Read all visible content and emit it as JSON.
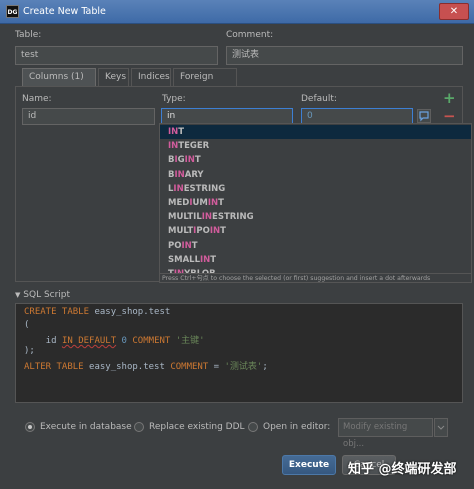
{
  "window": {
    "icon_text": "DG",
    "title": "Create New Table",
    "close": "✕"
  },
  "table_label": "Table:",
  "table_value": "test",
  "comment_label": "Comment:",
  "comment_value": "测试表",
  "tabs": [
    "Columns (1)",
    "Keys",
    "Indices",
    "Foreign Keys"
  ],
  "columns": {
    "headers": {
      "name": "Name:",
      "type": "Type:",
      "default": "Default:"
    },
    "row": {
      "name": "id",
      "type": "in",
      "default": "0"
    },
    "add": "+",
    "remove": "−"
  },
  "completion": {
    "items": [
      {
        "match": "IN",
        "rest": "T"
      },
      {
        "match": "IN",
        "rest": "TEGER"
      },
      {
        "pre": "B",
        "match": "I",
        "mid": "G",
        "match2": "IN",
        "rest": "T"
      },
      {
        "pre": "B",
        "match": "IN",
        "rest": "ARY"
      },
      {
        "pre": "L",
        "match": "IN",
        "rest": "ESTRING"
      },
      {
        "pre": "MED",
        "match": "I",
        "mid": "UM",
        "match2": "IN",
        "rest": "T"
      },
      {
        "pre": "MULTIL",
        "match": "IN",
        "rest": "ESTRING"
      },
      {
        "pre": "MULT",
        "match": "I",
        "mid": "PO",
        "match2": "IN",
        "rest": "T"
      },
      {
        "pre": "PO",
        "match": "IN",
        "rest": "T"
      },
      {
        "pre": "SMALL",
        "match": "IN",
        "rest": "T"
      },
      {
        "pre": "T",
        "match": "IN",
        "rest": "YBLOB"
      }
    ],
    "hint": "Press Ctrl+句点 to choose the selected (or first) suggestion and insert a dot afterwards"
  },
  "sql_section": "SQL Script",
  "sql": {
    "l1_kw": "CREATE TABLE",
    "l1_name": " easy_shop.test",
    "l2": "(",
    "l3_name": "    id ",
    "l3_kw": "IN DEFAULT",
    "l3_num": "0",
    "l3_kw2": "COMMENT",
    "l3_str": "'主键'",
    "l4": ");",
    "l5_kw": "ALTER TABLE",
    "l5_name": " easy_shop.test ",
    "l5_kw2": "COMMENT",
    "l5_eq": " = ",
    "l5_str": "'测试表'",
    "l5_end": ";"
  },
  "options": {
    "execute_db": "Execute in database",
    "replace_ddl": "Replace existing DDL",
    "open_editor": "Open in editor:",
    "editor_placeholder": "Modify existing obj..."
  },
  "buttons": {
    "execute": "Execute",
    "cancel": "Cancel"
  },
  "watermark": "知乎 @终端研发部"
}
